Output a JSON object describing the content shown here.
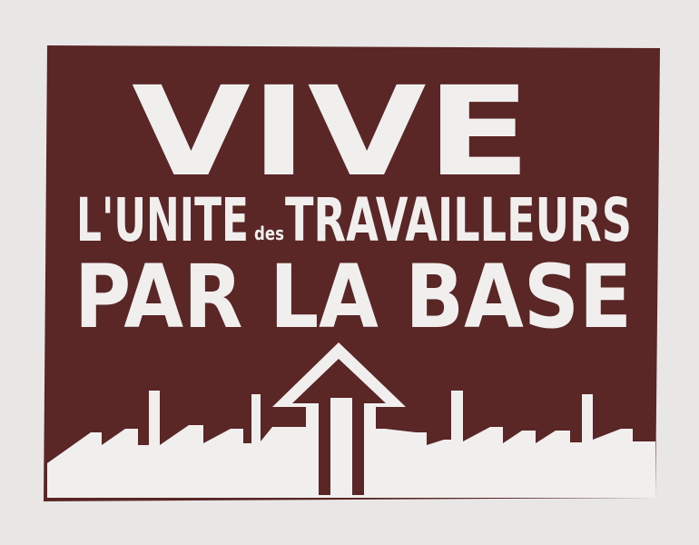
{
  "poster": {
    "line1": "VIVE",
    "line2_part1": "L'UNITE",
    "line2_small": "des",
    "line2_part2": "TRAVAILLEURS",
    "line3": "PAR LA BASE"
  },
  "colors": {
    "background": "#e9e7e6",
    "ink": "#5a2626",
    "paper_white": "#f1efee"
  },
  "icons": {
    "arrow": "up-arrow-icon",
    "factory": "factory-skyline-icon"
  }
}
